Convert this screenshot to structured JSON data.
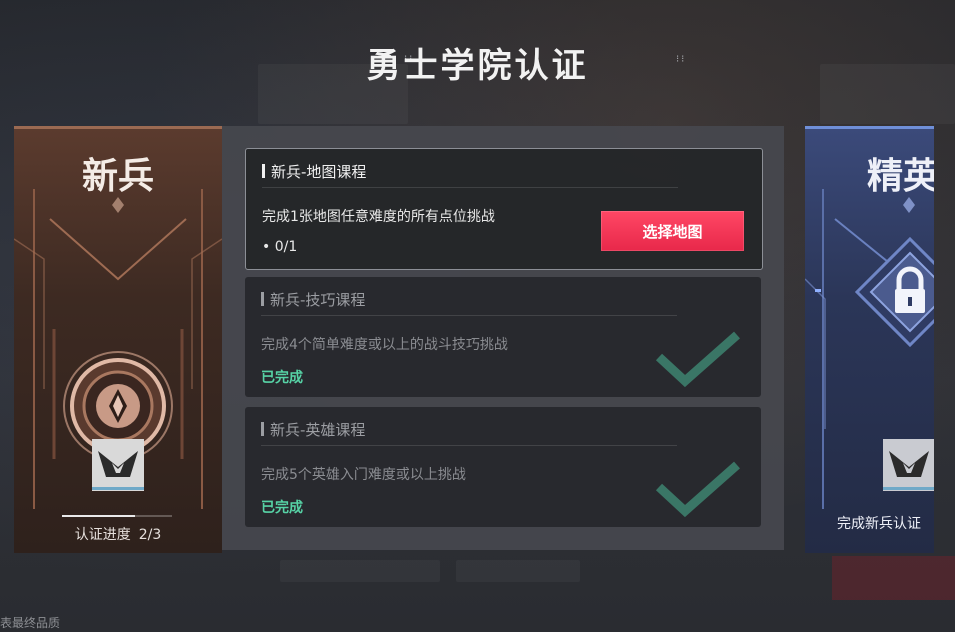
{
  "page_title": "勇士学院认证",
  "left_rank": {
    "name": "新兵",
    "progress_label": "认证进度",
    "progress_value": "2/3",
    "progress_fraction": 0.667
  },
  "courses": [
    {
      "title": "新兵-地图课程",
      "description": "完成1张地图任意难度的所有点位挑战",
      "progress": "• 0/1",
      "button_label": "选择地图",
      "completed": false
    },
    {
      "title": "新兵-技巧课程",
      "description": "完成4个简单难度或以上的战斗技巧挑战",
      "status": "已完成",
      "completed": true
    },
    {
      "title": "新兵-英雄课程",
      "description": "完成5个英雄入门难度或以上挑战",
      "status": "已完成",
      "completed": true
    }
  ],
  "right_rank": {
    "name": "精英",
    "requirement": "完成新兵认证"
  },
  "footer_note": "表最终品质",
  "colors": {
    "accent_red": "#f0324f",
    "complete_green": "#57d3a6",
    "recruit_bronze": "#9b6a52",
    "elite_blue": "#6f8fd8"
  }
}
